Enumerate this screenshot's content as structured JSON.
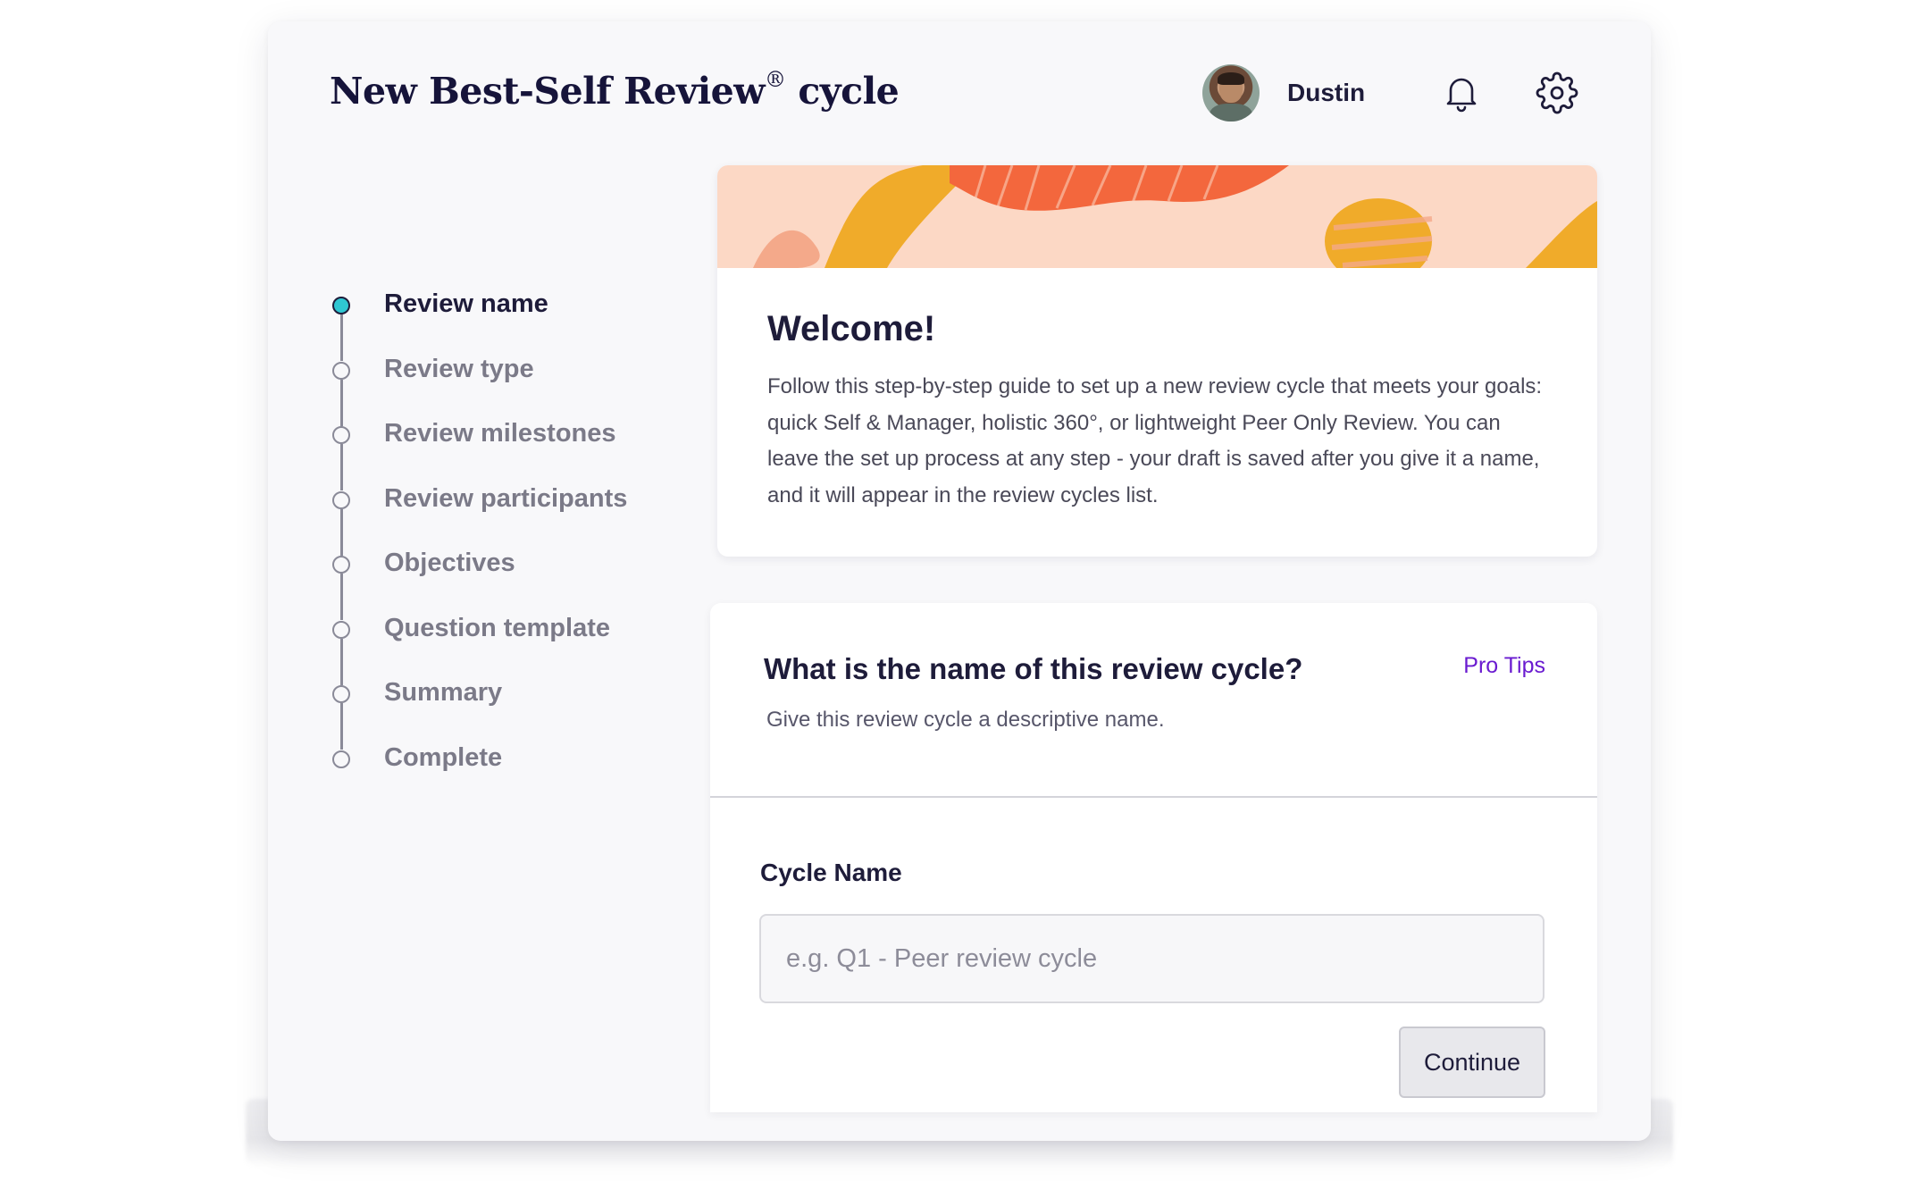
{
  "header": {
    "title": "New Best-Self Review",
    "title_mark": "®",
    "title_suffix": "cycle",
    "user_name": "Dustin",
    "notification_icon": "bell-icon",
    "settings_icon": "gear-icon"
  },
  "stepper": {
    "steps": [
      {
        "label": "Review name",
        "active": true
      },
      {
        "label": "Review type",
        "active": false
      },
      {
        "label": "Review milestones",
        "active": false
      },
      {
        "label": "Review participants",
        "active": false
      },
      {
        "label": "Objectives",
        "active": false
      },
      {
        "label": "Question template",
        "active": false
      },
      {
        "label": "Summary",
        "active": false
      },
      {
        "label": "Complete",
        "active": false
      }
    ]
  },
  "welcome": {
    "title": "Welcome!",
    "body": "Follow this step-by-step guide to set up a new review cycle that meets your goals: quick Self & Manager, holistic 360°, or lightweight Peer Only Review. You can leave the set up process at any step - your draft is saved after you give it a name, and it will appear in the review cycles list."
  },
  "form": {
    "question": "What is the name of this review cycle?",
    "pro_tips": "Pro Tips",
    "subtitle": "Give this review cycle a descriptive name.",
    "field_label": "Cycle Name",
    "field_value": "",
    "field_placeholder": "e.g. Q1 - Peer review cycle",
    "continue_label": "Continue"
  },
  "colors": {
    "accent_teal": "#2fc6d2",
    "link_purple": "#6a1bd0",
    "banner_peach": "#fcd8c5",
    "banner_orange": "#ef5a2c",
    "banner_gold": "#f0ab2a"
  }
}
